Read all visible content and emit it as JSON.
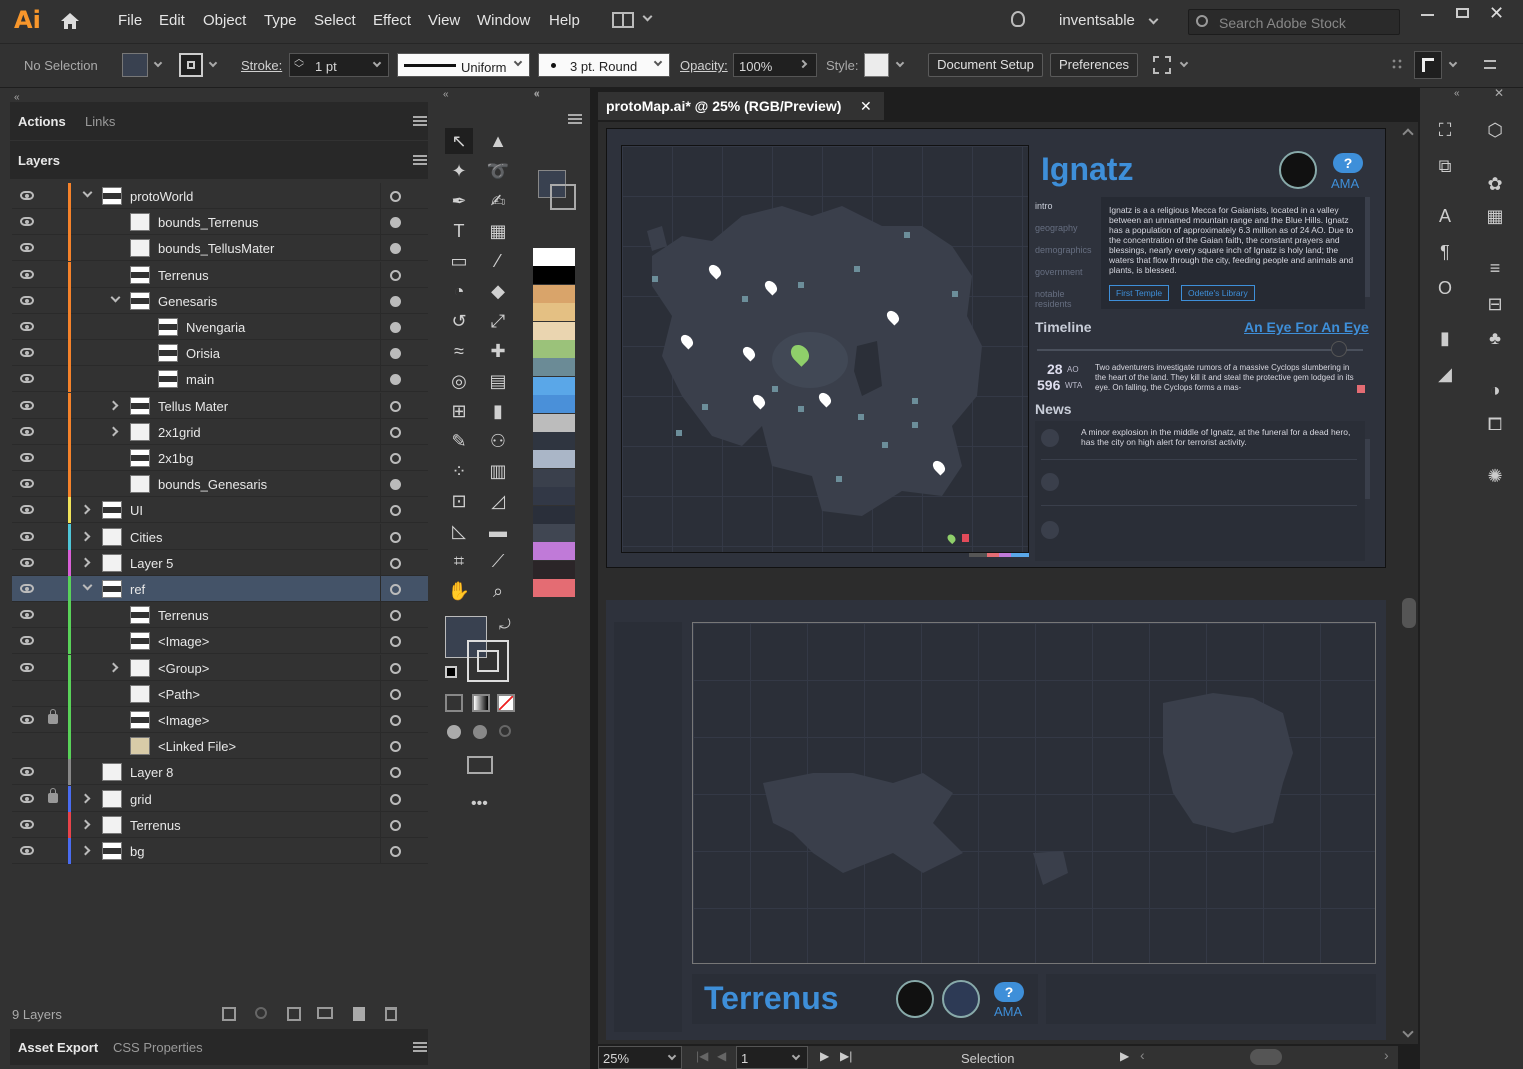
{
  "app": {
    "logo": "Ai",
    "accent": "#f7962b"
  },
  "menu": [
    "File",
    "Edit",
    "Object",
    "Type",
    "Select",
    "Effect",
    "View",
    "Window",
    "Help"
  ],
  "workspace": {
    "name": "inventsable",
    "search_placeholder": "Search Adobe Stock"
  },
  "control": {
    "selection": "No Selection",
    "stroke_label": "Stroke:",
    "stroke_weight": "1 pt",
    "profile": "Uniform",
    "brush": "3 pt. Round",
    "opacity_label": "Opacity:",
    "opacity": "100%",
    "style_label": "Style:",
    "document_setup": "Document Setup",
    "preferences": "Preferences"
  },
  "left_panel": {
    "tabs": [
      "Actions",
      "Links"
    ],
    "layers_tab": "Layers",
    "layers": [
      {
        "name": "protoWorld",
        "indent": 0,
        "expand": "down",
        "color": "#f5822a",
        "visible": true,
        "locked": false,
        "target": "ring",
        "thumb": "dark"
      },
      {
        "name": "bounds_Terrenus",
        "indent": 1,
        "expand": "",
        "color": "#f5822a",
        "visible": true,
        "locked": false,
        "target": "filled",
        "thumb": "plain"
      },
      {
        "name": "bounds_TellusMater",
        "indent": 1,
        "expand": "",
        "color": "#f5822a",
        "visible": true,
        "locked": false,
        "target": "filled",
        "thumb": "plain"
      },
      {
        "name": "Terrenus",
        "indent": 1,
        "expand": "",
        "color": "#f5822a",
        "visible": true,
        "locked": false,
        "target": "ring",
        "thumb": "dark"
      },
      {
        "name": "Genesaris",
        "indent": 1,
        "expand": "down",
        "color": "#f5822a",
        "visible": true,
        "locked": false,
        "target": "filled",
        "thumb": "dark"
      },
      {
        "name": "Nvengaria",
        "indent": 2,
        "expand": "",
        "color": "#f5822a",
        "visible": true,
        "locked": false,
        "target": "filled",
        "thumb": "dark"
      },
      {
        "name": "Orisia",
        "indent": 2,
        "expand": "",
        "color": "#f5822a",
        "visible": true,
        "locked": false,
        "target": "filled",
        "thumb": "dark"
      },
      {
        "name": "main",
        "indent": 2,
        "expand": "",
        "color": "#f5822a",
        "visible": true,
        "locked": false,
        "target": "filled",
        "thumb": "dark"
      },
      {
        "name": "Tellus Mater",
        "indent": 1,
        "expand": "right",
        "color": "#f5822a",
        "visible": true,
        "locked": false,
        "target": "ring",
        "thumb": "dark"
      },
      {
        "name": "2x1grid",
        "indent": 1,
        "expand": "right",
        "color": "#f5822a",
        "visible": true,
        "locked": false,
        "target": "ring",
        "thumb": "plain"
      },
      {
        "name": "2x1bg",
        "indent": 1,
        "expand": "",
        "color": "#f5822a",
        "visible": true,
        "locked": false,
        "target": "ring",
        "thumb": "dark"
      },
      {
        "name": "bounds_Genesaris",
        "indent": 1,
        "expand": "",
        "color": "#f5822a",
        "visible": true,
        "locked": false,
        "target": "filled",
        "thumb": "plain"
      },
      {
        "name": "UI",
        "indent": 0,
        "expand": "right",
        "color": "#f0e35a",
        "visible": true,
        "locked": false,
        "target": "ring",
        "thumb": "dark"
      },
      {
        "name": "Cities",
        "indent": 0,
        "expand": "right",
        "color": "#4fc6d8",
        "visible": true,
        "locked": false,
        "target": "ring",
        "thumb": "plain"
      },
      {
        "name": "Layer 5",
        "indent": 0,
        "expand": "right",
        "color": "#d95fd8",
        "visible": true,
        "locked": false,
        "target": "ring",
        "thumb": "plain"
      },
      {
        "name": "ref",
        "indent": 0,
        "expand": "down",
        "color": "#59d259",
        "visible": true,
        "locked": false,
        "target": "ring",
        "thumb": "dark",
        "selected": true
      },
      {
        "name": "Terrenus",
        "indent": 1,
        "expand": "",
        "color": "#59d259",
        "visible": true,
        "locked": false,
        "target": "ring",
        "thumb": "dark"
      },
      {
        "name": "<Image>",
        "indent": 1,
        "expand": "",
        "color": "#59d259",
        "visible": true,
        "locked": false,
        "target": "ring",
        "thumb": "dark"
      },
      {
        "name": "<Group>",
        "indent": 1,
        "expand": "right",
        "color": "#59d259",
        "visible": true,
        "locked": false,
        "target": "ring",
        "thumb": "plain"
      },
      {
        "name": "<Path>",
        "indent": 1,
        "expand": "",
        "color": "#59d259",
        "visible": false,
        "locked": false,
        "target": "ring",
        "thumb": "plain"
      },
      {
        "name": "<Image>",
        "indent": 1,
        "expand": "",
        "color": "#59d259",
        "visible": true,
        "locked": true,
        "target": "ring",
        "thumb": "dark"
      },
      {
        "name": "<Linked File>",
        "indent": 1,
        "expand": "",
        "color": "#59d259",
        "visible": false,
        "locked": false,
        "target": "ring",
        "thumb": "map"
      },
      {
        "name": "Layer 8",
        "indent": 0,
        "expand": "",
        "color": "#888888",
        "visible": true,
        "locked": false,
        "target": "ring",
        "thumb": "plain"
      },
      {
        "name": "grid",
        "indent": 0,
        "expand": "right",
        "color": "#4a6cf0",
        "visible": true,
        "locked": true,
        "target": "ring",
        "thumb": "plain"
      },
      {
        "name": "Terrenus",
        "indent": 0,
        "expand": "right",
        "color": "#e8434a",
        "visible": true,
        "locked": false,
        "target": "ring",
        "thumb": "plain"
      },
      {
        "name": "bg",
        "indent": 0,
        "expand": "right",
        "color": "#4a6cf0",
        "visible": true,
        "locked": false,
        "target": "ring",
        "thumb": "dark"
      }
    ],
    "layer_count": "9 Layers",
    "bottom_tabs": [
      "Asset Export",
      "CSS Properties"
    ]
  },
  "swatch_colors": [
    "#ffffff",
    "#000000",
    "#d9a46a",
    "#e4c083",
    "#ead5b0",
    "#9bc27a",
    "#6b8b96",
    "#5aa7e8",
    "#4a90d9",
    "#bcbcbc",
    "#2f3540",
    "#aab6c7",
    "#3a404c",
    "#323846",
    "#2a2f3a",
    "#404652",
    "#c07ad8",
    "#2b2528",
    "#e46c73"
  ],
  "document": {
    "tab_title": "protoMap.ai* @ 25% (RGB/Preview)",
    "zoom": "25%",
    "artboard": "1",
    "tool": "Selection"
  },
  "art": {
    "city_title": "Ignatz",
    "ama": "AMA",
    "sidebar_tabs": [
      "intro",
      "geography",
      "demographics",
      "government",
      "notable residents"
    ],
    "intro_text": "Ignatz is a a religious Mecca for Gaianists, located in a valley between an unnamed mountain range and the Blue Hills. Ignatz has a population of approximately 6.3 million as of 24 AO. Due to the concentration of the Gaian faith, the constant prayers and blessings, nearly every square inch of Ignatz is holy land; the waters that flow through the city, feeding people and animals and plants, is blessed.",
    "links": [
      "First Temple",
      "Odette's Library"
    ],
    "timeline_label": "Timeline",
    "timeline_link": "An Eye For An Eye",
    "date_ao": "28",
    "unit_ao": "AO",
    "date_wta": "596",
    "unit_wta": "WTA",
    "timeline_text": "Two adventurers investigate rumors of a massive Cyclops slumbering in the heart of the land. They kill it and steal the protective gem lodged in its eye. On falling, the Cyclops forms a mas-",
    "news_label": "News",
    "news_text": "A minor explosion in the middle of Ignatz, at the funeral for a dead hero, has the city on high alert for terrorist activity.",
    "world_title": "Terrenus",
    "accent_blue": "#3e8fd9"
  }
}
